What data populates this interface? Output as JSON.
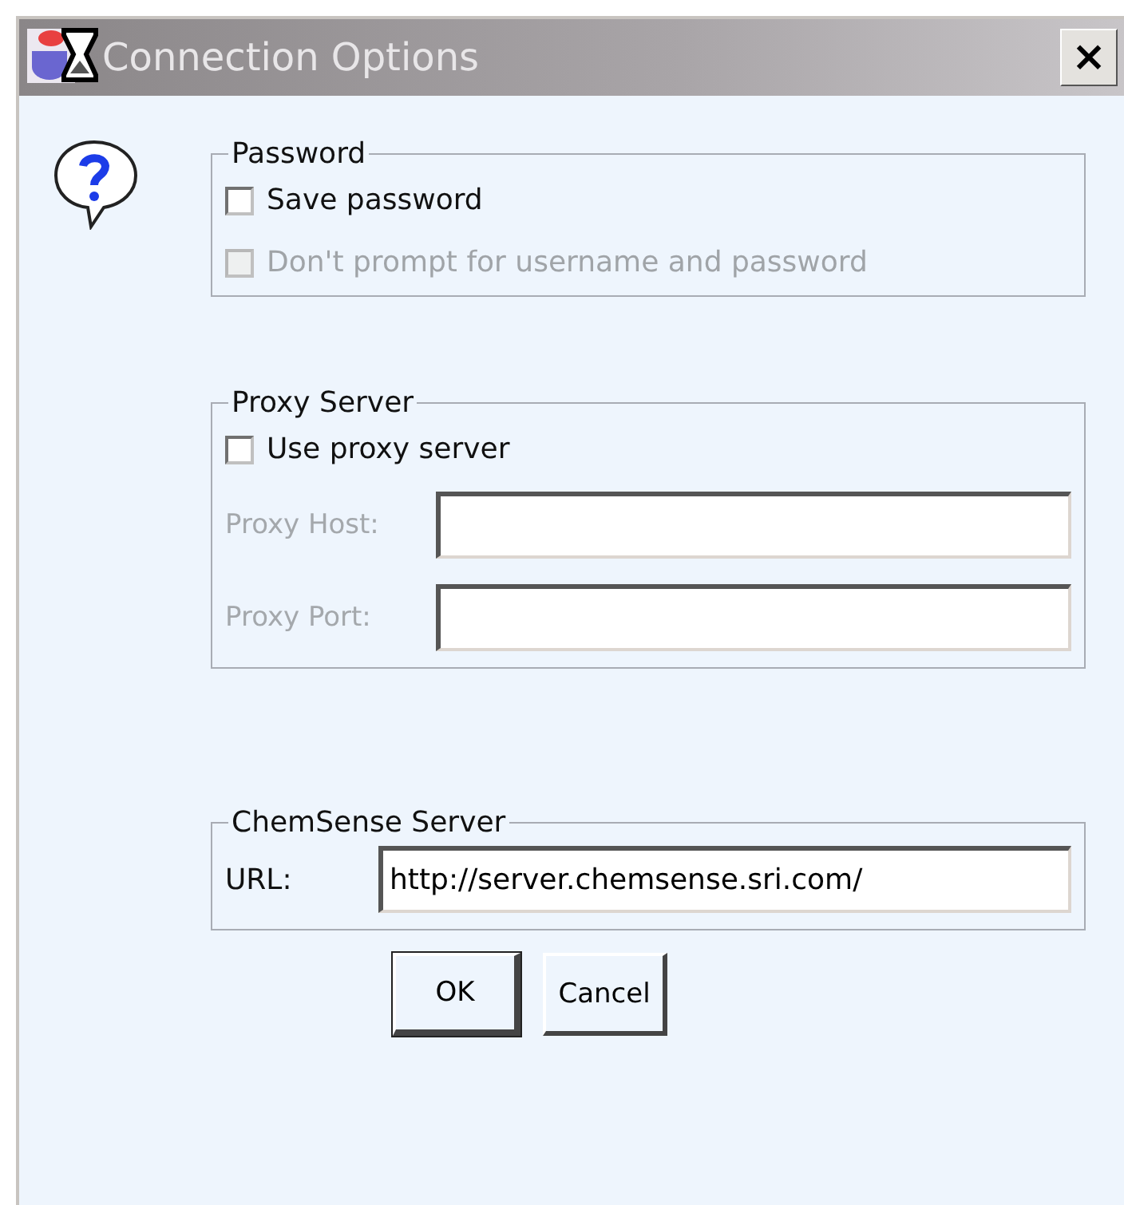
{
  "window": {
    "title": "Connection Options",
    "close": "×"
  },
  "groups": [
    {
      "title": "Password",
      "rows": [
        {
          "kind": "checkbox",
          "label": "Save password",
          "checked": false,
          "disabled": false
        },
        {
          "kind": "checkbox",
          "label": "Don't prompt for username and password",
          "checked": false,
          "disabled": true
        }
      ]
    },
    {
      "title": "Proxy Server",
      "rows": [
        {
          "kind": "checkbox",
          "label": "Use proxy server",
          "checked": false,
          "disabled": false
        },
        {
          "kind": "field",
          "label": "Proxy Host:",
          "value": "",
          "disabled": true
        },
        {
          "kind": "field",
          "label": "Proxy Port:",
          "value": "",
          "disabled": true
        }
      ]
    },
    {
      "title": "ChemSense Server",
      "rows": [
        {
          "kind": "field",
          "label": "URL:",
          "value": "http://server.chemsense.sri.com/",
          "disabled": false
        }
      ]
    }
  ],
  "buttons": [
    {
      "label": "OK",
      "default": true
    },
    {
      "label": "Cancel",
      "default": false
    }
  ]
}
